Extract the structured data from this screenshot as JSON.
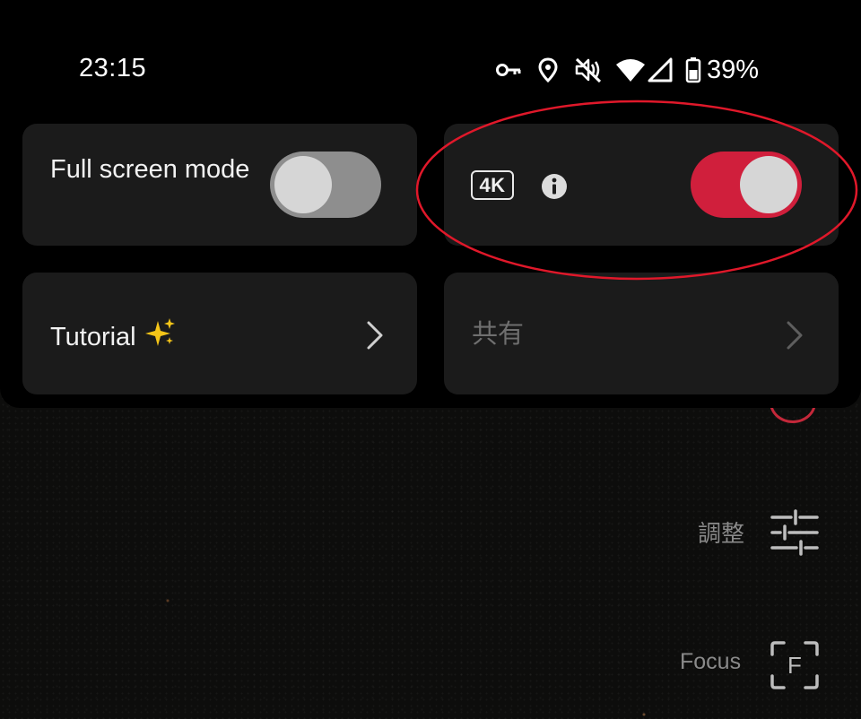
{
  "status_bar": {
    "time": "23:15",
    "battery_percent": "39%",
    "icons": [
      "vpn-key-icon",
      "location-icon",
      "mute-icon",
      "wifi-icon",
      "cell-signal-icon",
      "battery-icon"
    ]
  },
  "panel": {
    "fullscreen": {
      "label": "Full screen mode",
      "toggle_on": false
    },
    "quality": {
      "badge": "4K",
      "toggle_on": true,
      "info_icon": "info-icon"
    },
    "tutorial": {
      "label": "Tutorial",
      "emoji": "✨"
    },
    "share": {
      "label": "共有"
    }
  },
  "camera_controls": {
    "adjust_label": "調整",
    "focus_label": "Focus",
    "focus_glyph": "F"
  },
  "colors": {
    "accent": "#d01f3c",
    "highlight": "#e0182a",
    "tile_bg": "#1b1b1b",
    "toggle_off": "#8e8e8e"
  }
}
